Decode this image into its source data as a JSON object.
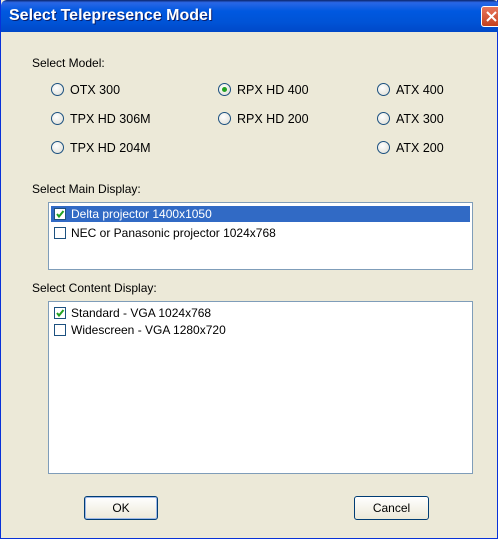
{
  "window": {
    "title": "Select Telepresence Model"
  },
  "model": {
    "label": "Select Model:",
    "options": [
      {
        "label": "OTX 300",
        "selected": false
      },
      {
        "label": "TPX HD 306M",
        "selected": false
      },
      {
        "label": "TPX HD 204M",
        "selected": false
      },
      {
        "label": "RPX HD 400",
        "selected": true
      },
      {
        "label": "RPX HD 200",
        "selected": false
      },
      {
        "label": "ATX 400",
        "selected": false
      },
      {
        "label": "ATX 300",
        "selected": false
      },
      {
        "label": "ATX 200",
        "selected": false
      }
    ]
  },
  "main_display": {
    "label": "Select Main Display:",
    "items": [
      {
        "label": "Delta projector 1400x1050",
        "checked": true,
        "selected": true
      },
      {
        "label": "NEC or Panasonic projector 1024x768",
        "checked": false,
        "selected": false
      }
    ]
  },
  "content_display": {
    "label": "Select Content Display:",
    "items": [
      {
        "label": "Standard - VGA 1024x768",
        "checked": true
      },
      {
        "label": "Widescreen - VGA 1280x720",
        "checked": false
      }
    ]
  },
  "buttons": {
    "ok": "OK",
    "cancel": "Cancel"
  },
  "colors": {
    "title_bar": "#0053d6",
    "selection": "#316ac5",
    "radio_dot": "#21a121",
    "check": "#21a121",
    "dialog_bg": "#ece9d8"
  }
}
